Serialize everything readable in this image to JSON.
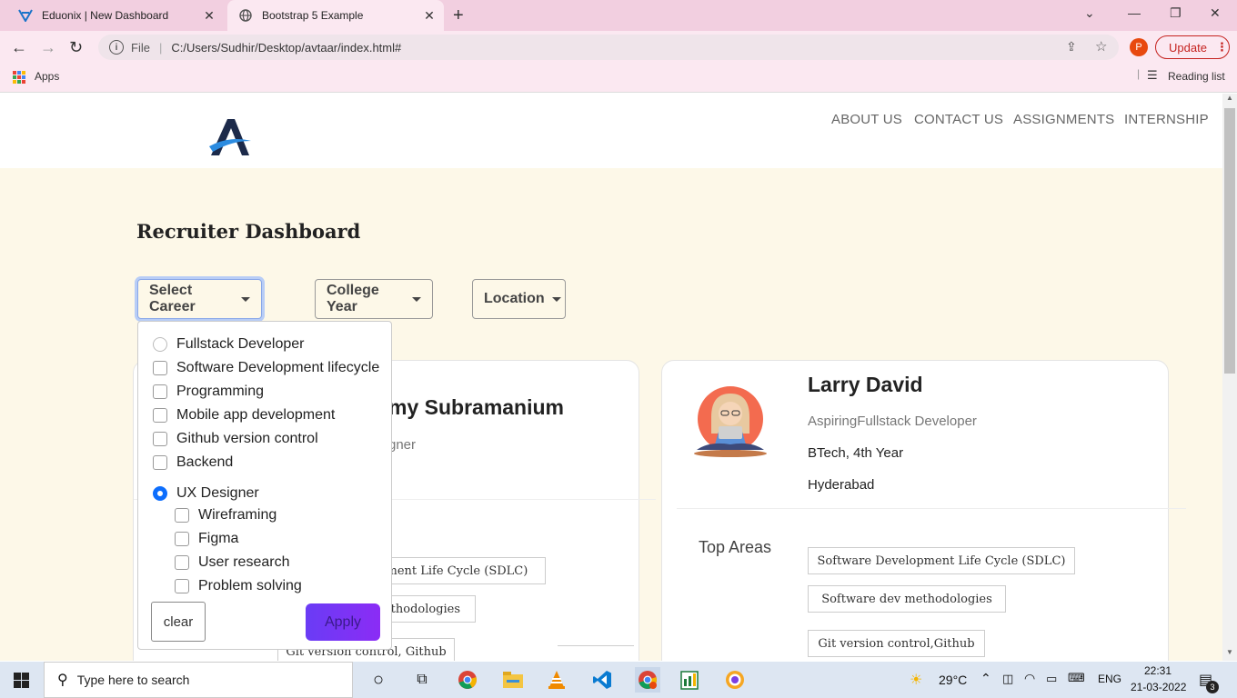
{
  "browser": {
    "tabs": [
      {
        "title": "Eduonix | New Dashboard"
      },
      {
        "title": "Bootstrap 5 Example"
      }
    ],
    "new_tab": "+",
    "address": {
      "prefix": "File",
      "url": "C:/Users/Sudhir/Desktop/avtaar/index.html#"
    },
    "profile_initial": "P",
    "update_label": "Update",
    "bookmarks": {
      "apps": "Apps",
      "reading_list": "Reading list"
    }
  },
  "site": {
    "logo": "A",
    "nav": [
      "ABOUT US",
      "CONTACT US",
      "ASSIGNMENTS",
      "INTERNSHIP"
    ]
  },
  "dashboard": {
    "title": "Recruiter Dashboard",
    "filters": [
      "Select Career",
      "College Year",
      "Location"
    ]
  },
  "career_menu": {
    "options": [
      {
        "label": "Fullstack Developer",
        "type": "radio",
        "checked": false
      },
      {
        "label": "Software Development lifecycle",
        "type": "checkbox",
        "checked": false
      },
      {
        "label": "Programming",
        "type": "checkbox",
        "checked": false
      },
      {
        "label": "Mobile app development",
        "type": "checkbox",
        "checked": false
      },
      {
        "label": "Github version control",
        "type": "checkbox",
        "checked": false
      },
      {
        "label": "Backend",
        "type": "checkbox",
        "checked": false
      },
      {
        "label": "UX Designer",
        "type": "radio",
        "checked": true
      }
    ],
    "sub_options": [
      "Wireframing",
      "Figma",
      "User research",
      "Problem solving"
    ],
    "clear_label": "clear",
    "apply_label": "Apply"
  },
  "card1": {
    "name_fragment": "my Subramanium",
    "role_fragment": "gner",
    "tags": [
      "oment Life Cycle (SDLC)",
      "ethodologies",
      "Git version control, Github"
    ]
  },
  "card2": {
    "name": "Larry David",
    "role": "AspiringFullstack Developer",
    "year": "BTech, 4th Year",
    "location": "Hyderabad",
    "top_areas_label": "Top Areas",
    "tags": [
      "Software Development Life Cycle (SDLC)",
      "Software dev methodologies",
      "Git version control,Github"
    ]
  },
  "taskbar": {
    "search_placeholder": "Type here to search",
    "weather": "29°C",
    "language": "ENG",
    "time": "22:31",
    "date": "21-03-2022",
    "notifications": "3"
  },
  "colors": {
    "accent": "#0d6efd",
    "page_bg": "#fdf8e8",
    "apply_gradient_start": "#6a3cf5",
    "update_red": "#c5221f"
  }
}
